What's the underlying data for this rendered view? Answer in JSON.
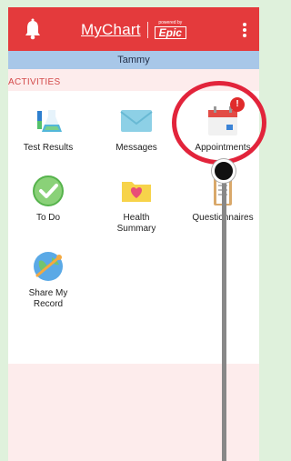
{
  "header": {
    "brand_name": "MyChart",
    "powered_by": "powered by",
    "epic": "Epic",
    "bell_icon": "bell-icon",
    "menu_icon": "kebab-menu-icon"
  },
  "user": {
    "name": "Tammy"
  },
  "activities": {
    "title": "ACTIVITIES",
    "tiles": [
      {
        "label": "Test Results",
        "icon": "flask-icon"
      },
      {
        "label": "Messages",
        "icon": "envelope-icon"
      },
      {
        "label": "Appointments",
        "icon": "calendar-icon",
        "badge": "!"
      },
      {
        "label": "To Do",
        "icon": "checkmark-icon"
      },
      {
        "label": "Health Summary",
        "icon": "folder-heart-icon"
      },
      {
        "label": "Questionnaires",
        "icon": "clipboard-icon"
      },
      {
        "label": "Share My Record",
        "icon": "globe-share-icon"
      }
    ]
  },
  "colors": {
    "header": "#e43a3c",
    "userbar": "#a8c7e8",
    "section_title": "#d34a4a",
    "annotation": "#e2243b"
  }
}
